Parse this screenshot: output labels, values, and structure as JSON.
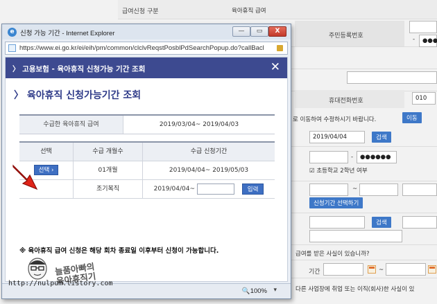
{
  "background": {
    "row_title_label": "급여신청 구분",
    "row_title_value": "육아휴직 급여",
    "resident_label": "주민등록번호",
    "resident_dash": "-",
    "resident_mask": "●●●",
    "phone_label": "휴대전화번호",
    "phone_prefix": "010",
    "phone_dash": "-",
    "move_notice": "로 이동하여 수정하시기 바랍니다.",
    "move_button": "이동",
    "date_value": "2019/04/04",
    "search_button": "검색",
    "child_dash": "-",
    "child_mask": "●●●●●●",
    "school_check": "초등학교 2학년 여부",
    "tilde": "~",
    "period_button": "신청기간 선택하기",
    "search_button2": "검색",
    "benefit_question": "급여를 받은 사실이 있습니까?",
    "period_label": "기간",
    "tilde2": "~",
    "other_job_question": "다른 사업장에 취업 또는 이직(회사)한 사실이 있"
  },
  "popup": {
    "window_title": "신청 가능 기간 - Internet Explorer",
    "url": "https://www.ei.go.kr/ei/eih/pm/common/clclvReqstPosblPdSearchPopup.do?callBacl",
    "header_title": "고용보험 - 육아휴직 신청가능 기간 조회",
    "header_arrow": "〉",
    "close_icon": "✕",
    "sub_title": "육아휴직 신청가능기간 조회",
    "sub_arrow": "〉",
    "received_label": "수급한 육아휴직 급여",
    "received_value": "2019/03/04~ 2019/04/03",
    "table_headers": [
      "선택",
      "수급 개월수",
      "수급 신청기간"
    ],
    "rows": [
      {
        "select": "선택 ›",
        "months": "01개월",
        "period": "2019/04/04~ 2019/05/03"
      },
      {
        "select": "",
        "months": "조기복직",
        "period": "2019/04/04~",
        "input_button": "입력"
      }
    ],
    "notice": "※ 육아휴직 급여 신청은 해당 회차 종료일 이후부터 신청이 가능합니다.",
    "zoom": "100%",
    "zoom_arrow": "▾",
    "buttons": {
      "minimize": "—",
      "maximize": "▭",
      "close": "X"
    }
  },
  "watermark": {
    "line1": "늘품아빠의",
    "line2": "육아휴직기",
    "blog_url": "http://nulpum.tistory.com"
  },
  "colors": {
    "header_blue": "#3d4a90",
    "button_blue": "#3e6fc2",
    "arrow_red": "#e02418"
  }
}
